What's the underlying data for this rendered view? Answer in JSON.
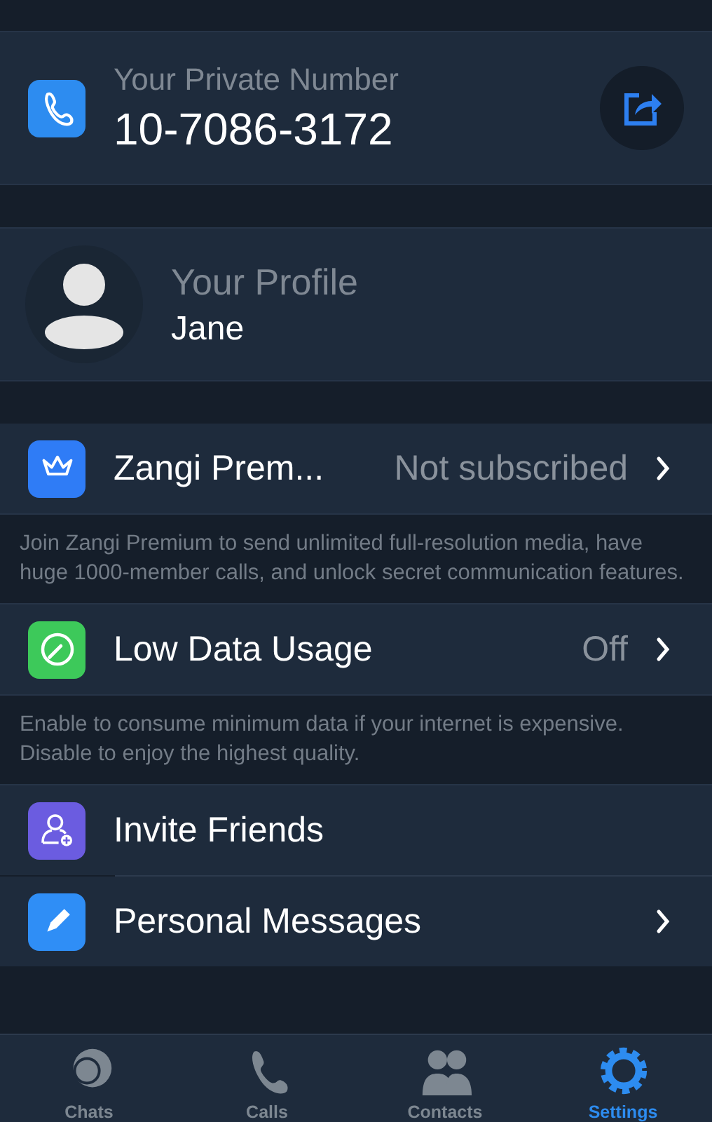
{
  "private_number": {
    "label": "Your Private Number",
    "value": "10-7086-3172"
  },
  "profile": {
    "label": "Your Profile",
    "name": "Jane"
  },
  "sections": [
    {
      "rows": [
        {
          "title": "Zangi Prem...",
          "value": "Not subscribed",
          "chevron": true,
          "color": "#2f7cf6"
        }
      ],
      "note": "Join Zangi Premium to send unlimited full-resolution media, have huge 1000-member calls, and unlock secret communication features."
    },
    {
      "rows": [
        {
          "title": "Low Data Usage",
          "value": "Off",
          "chevron": true,
          "color": "#3dc95a"
        }
      ],
      "note": "Enable to consume minimum data if your internet is expensive. Disable to enjoy the highest quality."
    },
    {
      "rows": [
        {
          "title": "Invite Friends",
          "chevron": false,
          "color": "#6b5ce0"
        },
        {
          "title": "Personal Messages",
          "chevron": true,
          "color": "#2f8ef6"
        }
      ]
    }
  ],
  "tabs": [
    {
      "label": "Chats",
      "selected": false
    },
    {
      "label": "Calls",
      "selected": false
    },
    {
      "label": "Contacts",
      "selected": false
    },
    {
      "label": "Settings",
      "selected": true
    }
  ]
}
